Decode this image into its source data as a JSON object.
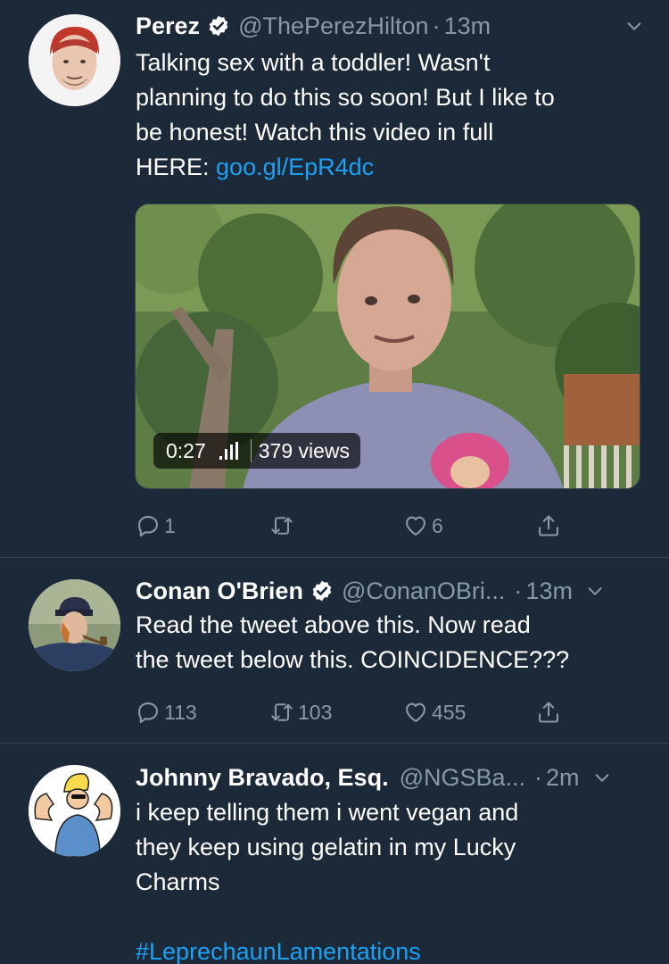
{
  "tweets": [
    {
      "name": "Perez",
      "handle": "@ThePerezHilton",
      "separator": "·",
      "time": "13m",
      "text_lines": [
        "Talking sex with a toddler! Wasn't",
        "planning to do this so soon! But I like to",
        "be honest! Watch this video in full"
      ],
      "last_line_prefix": "HERE: ",
      "link": "goo.gl/EpR4dc",
      "media": {
        "duration": "0:27",
        "views": "379 views"
      },
      "replies": "1",
      "retweets": "",
      "likes": "6"
    },
    {
      "name": "Conan O'Brien",
      "handle": "@ConanOBri...",
      "separator": "·",
      "time": "13m",
      "text_lines": [
        "Read the tweet above this. Now read",
        "the tweet below this. COINCIDENCE???"
      ],
      "replies": "113",
      "retweets": "103",
      "likes": "455"
    },
    {
      "name": "Johnny Bravado, Esq.",
      "handle": "@NGSBa...",
      "separator": "·",
      "time": "2m",
      "text_lines": [
        "i keep telling them i went vegan and",
        "they keep using gelatin in my Lucky",
        "Charms"
      ],
      "hashtag": "#LeprechaunLamentations"
    }
  ],
  "colors": {
    "background": "#1c2938",
    "secondary": "#8899a6",
    "link": "#1da1f2",
    "divider": "#38444d"
  },
  "icons": [
    "verified-badge-icon",
    "chevron-down-icon",
    "reply-icon",
    "retweet-icon",
    "like-icon",
    "share-icon",
    "audio-bars-icon"
  ]
}
